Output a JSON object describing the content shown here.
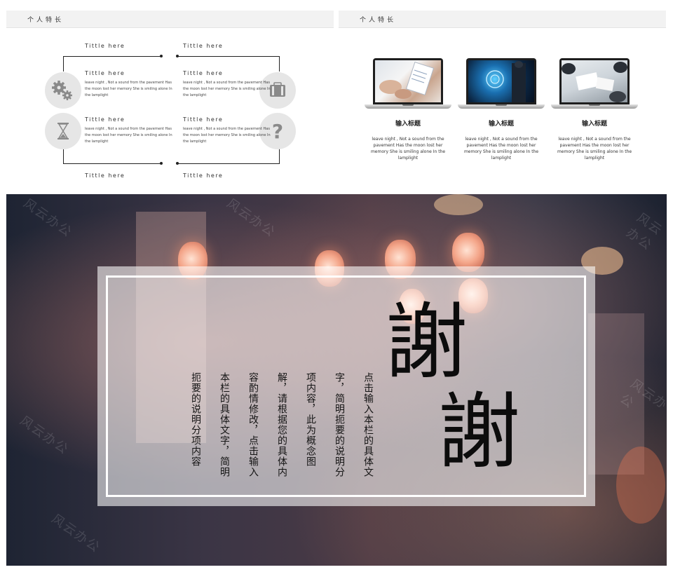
{
  "slide1": {
    "header": "个人特长",
    "top_left_title": "Tittle here",
    "top_right_title": "Tittle here",
    "bottom_left_title": "Tittle here",
    "bottom_right_title": "Tittle here",
    "items": [
      {
        "title": "Tittle here",
        "text": "leave night , Not a sound from the pavement Has the moon lost her memory She is smiling alone In the lamplight",
        "icon": "gears-icon"
      },
      {
        "title": "Tittle here",
        "text": "leave night , Not a sound from the pavement Has the moon lost her memory She is smiling alone In the lamplight",
        "icon": "briefcase-icon"
      },
      {
        "title": "Tittle here",
        "text": "leave night , Not a sound from the pavement Has the moon lost her memory She is smiling alone In the lamplight",
        "icon": "hourglass-icon"
      },
      {
        "title": "Tittle here",
        "text": "leave night , Not a sound from the pavement Has the moon lost her memory She is smiling alone In the lamplight",
        "icon": "question-icon"
      }
    ],
    "icon_color": "#8a8a8a",
    "circle_color": "#e6e6e6"
  },
  "slide2": {
    "header": "个人特长",
    "cards": [
      {
        "title": "输入标题",
        "text": "leave night , Not a sound from the pavement Has the moon lost her memory She is smiling alone In the lamplight"
      },
      {
        "title": "输入标题",
        "text": "leave night , Not a sound from the pavement Has the moon lost her memory She is smiling alone In the lamplight"
      },
      {
        "title": "输入标题",
        "text": "leave night , Not a sound from the pavement Has the moon lost her memory She is smiling alone In the lamplight"
      }
    ]
  },
  "slide3": {
    "thanks_char_1": "謝",
    "thanks_char_2": "謝",
    "columns": [
      "点击输入本栏的具体文",
      "字，简明扼要的说明分",
      "项内容，此为概念图",
      "解，请根据您的具体内",
      "容酌情修改，点击输入",
      "本栏的具体文字，简明",
      "扼要的说明分项内容"
    ],
    "watermark": "风云办公"
  }
}
